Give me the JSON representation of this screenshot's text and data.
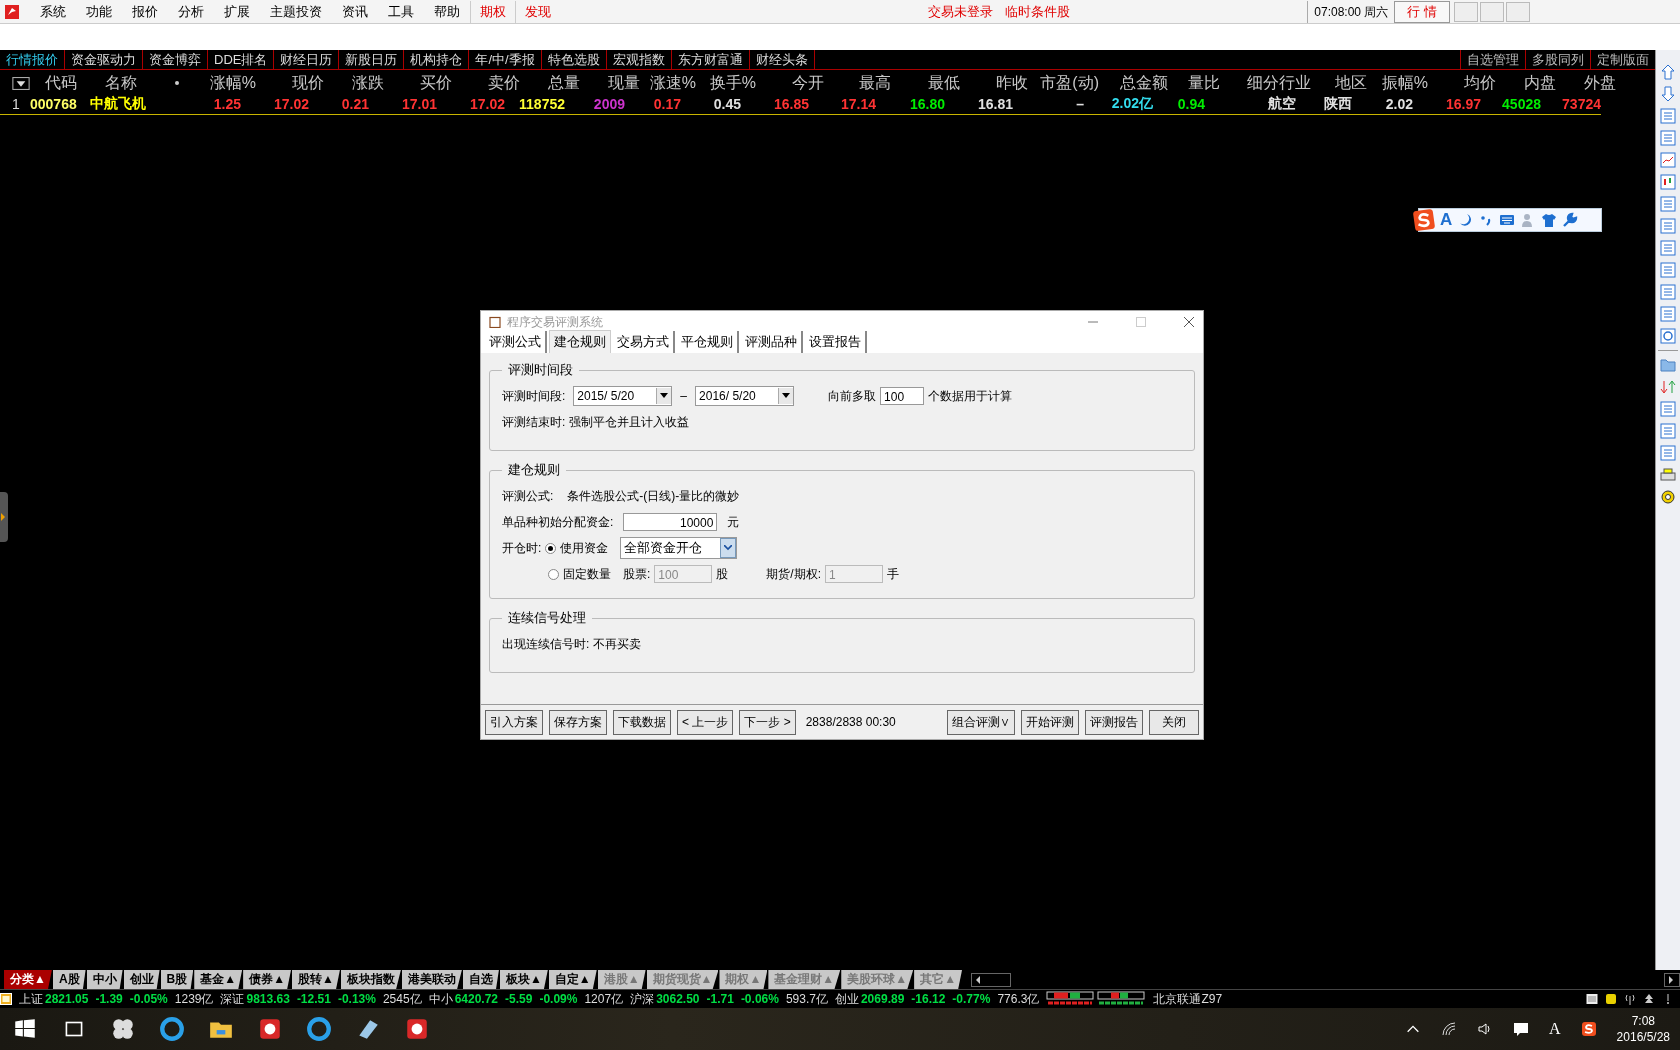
{
  "menu_bar": {
    "items": [
      "系统",
      "功能",
      "报价",
      "分析",
      "扩展",
      "主题投资",
      "资讯",
      "工具",
      "帮助"
    ],
    "highlight_items": [
      "期权",
      "发现"
    ],
    "status_texts": [
      "交易未登录",
      "临时条件股"
    ],
    "clock": "07:08:00 周六",
    "mode_button": "行  情"
  },
  "quote_tabs": [
    {
      "label": "行情报价",
      "selected": true
    },
    {
      "label": "资金驱动力",
      "selected": false
    },
    {
      "label": "资金博弈",
      "selected": false
    },
    {
      "label": "DDE排名",
      "selected": false
    },
    {
      "label": "财经日历",
      "selected": false
    },
    {
      "label": "新股日历",
      "selected": false
    },
    {
      "label": "机构持仓",
      "selected": false
    },
    {
      "label": "年/中/季报",
      "selected": false
    },
    {
      "label": "特色选股",
      "selected": false
    },
    {
      "label": "宏观指数",
      "selected": false
    },
    {
      "label": "东方财富通",
      "selected": false
    },
    {
      "label": "财经头条",
      "selected": false
    }
  ],
  "panel_tabs": [
    "自选管理",
    "多股同列",
    "定制版面"
  ],
  "table": {
    "row_number": "1",
    "columns": [
      {
        "header": "代码",
        "value": "000768",
        "color": "#ffff66"
      },
      {
        "header": "名称",
        "value": "中航飞机",
        "color": "#ffff00"
      },
      {
        "header": "涨幅%",
        "value": "1.25",
        "color": "#ff3333"
      },
      {
        "header": "现价",
        "value": "17.02",
        "color": "#ff3333"
      },
      {
        "header": "涨跌",
        "value": "0.21",
        "color": "#ff3333"
      },
      {
        "header": "买价",
        "value": "17.01",
        "color": "#ff3333"
      },
      {
        "header": "卖价",
        "value": "17.02",
        "color": "#ff3333"
      },
      {
        "header": "总量",
        "value": "118752",
        "color": "#ffff33"
      },
      {
        "header": "现量",
        "value": "2009",
        "color": "#cc33cc"
      },
      {
        "header": "涨速%",
        "value": "0.17",
        "color": "#ff3333"
      },
      {
        "header": "换手%",
        "value": "0.45",
        "color": "#e0e0e0"
      },
      {
        "header": "今开",
        "value": "16.85",
        "color": "#ff3333"
      },
      {
        "header": "最高",
        "value": "17.14",
        "color": "#ff3333"
      },
      {
        "header": "最低",
        "value": "16.80",
        "color": "#00ee00"
      },
      {
        "header": "昨收",
        "value": "16.81",
        "color": "#e0e0e0"
      },
      {
        "header": "市盈(动)",
        "value": "–",
        "color": "#e0e0e0"
      },
      {
        "header": "总金额",
        "value": "2.02亿",
        "color": "#33ddee"
      },
      {
        "header": "量比",
        "value": "0.94",
        "color": "#00ee00"
      },
      {
        "header": "细分行业",
        "value": "航空",
        "color": "#e0e0e0"
      },
      {
        "header": "地区",
        "value": "陕西",
        "color": "#e0e0e0"
      },
      {
        "header": "振幅%",
        "value": "2.02",
        "color": "#e0e0e0"
      },
      {
        "header": "均价",
        "value": "16.97",
        "color": "#ff3333"
      },
      {
        "header": "内盘",
        "value": "45028",
        "color": "#00ee00"
      },
      {
        "header": "外盘",
        "value": "73724",
        "color": "#ff3333"
      }
    ]
  },
  "ime_toolbar": {
    "letter": "A"
  },
  "dialog": {
    "title": "程序交易评测系统",
    "tabs": [
      {
        "label": "评测公式",
        "selected": false
      },
      {
        "label": "建仓规则",
        "selected": true
      },
      {
        "label": "交易方式",
        "selected": false
      },
      {
        "label": "平仓规则",
        "selected": false
      },
      {
        "label": "评测品种",
        "selected": false
      },
      {
        "label": "设置报告",
        "selected": false
      }
    ],
    "period_group": {
      "legend": "评测时间段",
      "range_label": "评测时间段:",
      "start_date": "2015/ 5/20",
      "dash": "–",
      "end_date": "2016/ 5/20",
      "lookback_label": "向前多取",
      "lookback_value": "100",
      "lookback_suffix": "个数据用于计算",
      "end_text": "评测结束时: 强制平仓并且计入收益"
    },
    "open_group": {
      "legend": "建仓规则",
      "formula_label": "评测公式:",
      "formula_value": "条件选股公式-(日线)-量比的微妙",
      "capital_label": "单品种初始分配资金:",
      "capital_value": "10000",
      "capital_unit": "元",
      "open_label": "开仓时:",
      "options": [
        {
          "label": "使用资金",
          "selected": true
        },
        {
          "label": "固定数量",
          "selected": false
        }
      ],
      "fund_mode": "全部资金开仓",
      "stock_label": "股票:",
      "stock_qty": "100",
      "stock_unit": "股",
      "futures_label": "期货/期权:",
      "futures_qty": "1",
      "futures_unit": "手"
    },
    "signal_group": {
      "legend": "连续信号处理",
      "text": "出现连续信号时: 不再买卖"
    },
    "left_buttons": [
      "引入方案",
      "保存方案",
      "下载数据",
      "< 上一步",
      "下一步 >"
    ],
    "progress": "2838/2838  00:30",
    "right_buttons": [
      "组合评测∨",
      "开始评测",
      "评测报告",
      "关闭"
    ]
  },
  "category_tabs": [
    {
      "label": "分类▲",
      "selected": true,
      "disabled": false
    },
    {
      "label": "A股",
      "selected": false,
      "disabled": false
    },
    {
      "label": "中小",
      "selected": false,
      "disabled": false
    },
    {
      "label": "创业",
      "selected": false,
      "disabled": false
    },
    {
      "label": "B股",
      "selected": false,
      "disabled": false
    },
    {
      "label": "基金▲",
      "selected": false,
      "disabled": false
    },
    {
      "label": "债券▲",
      "selected": false,
      "disabled": false
    },
    {
      "label": "股转▲",
      "selected": false,
      "disabled": false
    },
    {
      "label": "板块指数",
      "selected": false,
      "disabled": false
    },
    {
      "label": "港美联动",
      "selected": false,
      "disabled": false
    },
    {
      "label": "自选",
      "selected": false,
      "disabled": false
    },
    {
      "label": "板块▲",
      "selected": false,
      "disabled": false
    },
    {
      "label": "自定▲",
      "selected": false,
      "disabled": false
    },
    {
      "label": "港股▲",
      "selected": false,
      "disabled": true
    },
    {
      "label": "期货现货▲",
      "selected": false,
      "disabled": true
    },
    {
      "label": "期权▲",
      "selected": false,
      "disabled": true
    },
    {
      "label": "基金理财▲",
      "selected": false,
      "disabled": true
    },
    {
      "label": "美股环球▲",
      "selected": false,
      "disabled": true
    },
    {
      "label": "其它▲",
      "selected": false,
      "disabled": true
    }
  ],
  "ticker": [
    {
      "name": "上证",
      "value": "2821.05",
      "change": "-1.39",
      "pct": "-0.05%",
      "amount": "1239亿"
    },
    {
      "name": "深证",
      "value": "9813.63",
      "change": "-12.51",
      "pct": "-0.13%",
      "amount": "2545亿"
    },
    {
      "name": "中小",
      "value": "6420.72",
      "change": "-5.59",
      "pct": "-0.09%",
      "amount": "1207亿"
    },
    {
      "name": "沪深",
      "value": "3062.50",
      "change": "-1.71",
      "pct": "-0.06%",
      "amount": "593.7亿"
    },
    {
      "name": "创业",
      "value": "2069.89",
      "change": "-16.12",
      "pct": "-0.77%",
      "amount": "776.3亿"
    }
  ],
  "broker": "北京联通Z97",
  "taskbar": {
    "tray_letter": "A",
    "time": "7:08",
    "date": "2016/5/28"
  }
}
